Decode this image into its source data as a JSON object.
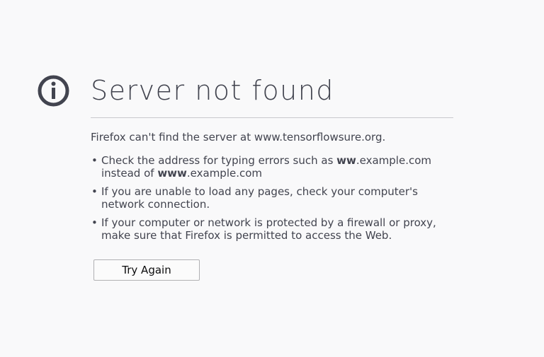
{
  "icon": "info-circle-icon",
  "title": "Server not found",
  "description": "Firefox can't find the server at www.tensorflowsure.org.",
  "tips": [
    {
      "line1_pre": "Check the address for typing errors such as ",
      "line1_bold": "ww",
      "line1_post": ".example.com",
      "line2_pre": "instead of ",
      "line2_bold": "www",
      "line2_post": ".example.com"
    },
    {
      "line1": "If you are unable to load any pages, check your computer's",
      "line2": "network connection."
    },
    {
      "line1": "If your computer or network is protected by a firewall or proxy,",
      "line2": "make sure that Firefox is permitted to access the Web."
    }
  ],
  "try_again_label": "Try Again",
  "colors": {
    "text": "#42444f",
    "background": "#f9f9fa",
    "rule": "#c9c9cd"
  }
}
